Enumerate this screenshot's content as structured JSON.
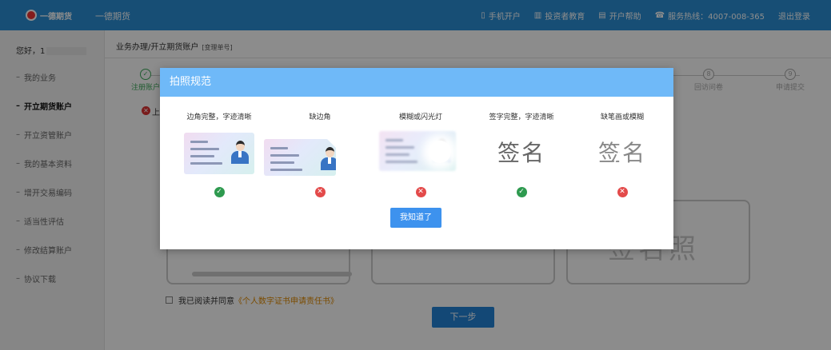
{
  "header": {
    "logo_text": "一德期货",
    "brand": "一德期货",
    "nav": [
      {
        "icon": "mobile-icon",
        "glyph": "▯",
        "label": "手机开户"
      },
      {
        "icon": "education-icon",
        "glyph": "▥",
        "label": "投资者教育"
      },
      {
        "icon": "help-icon",
        "glyph": "▤",
        "label": "开户帮助"
      },
      {
        "icon": "phone-icon",
        "glyph": "☎",
        "label": "服务热线：4007-008-365"
      },
      {
        "icon": "",
        "glyph": "",
        "label": "退出登录"
      }
    ]
  },
  "sidebar": {
    "greeting": "您好，1",
    "items": [
      {
        "label": "我的业务"
      },
      {
        "label": "开立期货账户",
        "active": true
      },
      {
        "label": "开立资管账户"
      },
      {
        "label": "我的基本资料"
      },
      {
        "label": "增开交易编码"
      },
      {
        "label": "适当性评估"
      },
      {
        "label": "修改结算账户"
      },
      {
        "label": "协议下载"
      }
    ]
  },
  "main": {
    "breadcrumb": "业务办理/开立期货账户",
    "breadcrumb_tag": "[变理单号]",
    "steps": [
      {
        "label": "注册账户",
        "mark": "✓",
        "done": true
      },
      {
        "label": "",
        "mark": "",
        "done": false
      },
      {
        "label": "",
        "mark": "",
        "done": false
      },
      {
        "label": "",
        "mark": "",
        "done": false
      },
      {
        "label": "",
        "mark": "",
        "done": false
      },
      {
        "label": "回访问卷",
        "mark": "8",
        "done": false
      },
      {
        "label": "申请提交",
        "mark": "9",
        "done": false
      }
    ],
    "warning_text": "上",
    "photo_placeholder_text": "签名照",
    "agree_prefix": "我已阅读并同意",
    "agree_link": "《个人数字证书申请责任书》",
    "next_button": "下一步"
  },
  "modal": {
    "title": "拍照规范",
    "examples": [
      {
        "caption": "边角完整，字迹清晰",
        "type": "card",
        "status": "ok"
      },
      {
        "caption": "缺边角",
        "type": "card-cut",
        "status": "bad"
      },
      {
        "caption": "模糊或闪光灯",
        "type": "card-blur",
        "status": "bad"
      },
      {
        "caption": "签字完整，字迹清晰",
        "type": "sign",
        "text": "签名",
        "status": "ok"
      },
      {
        "caption": "缺笔画或模糊",
        "type": "sign-broken",
        "text": "签名",
        "status": "bad"
      }
    ],
    "ok_mark": "✓",
    "bad_mark": "✕",
    "ok_button": "我知道了"
  },
  "colors": {
    "header_bg": "#2b8fd6",
    "modal_header_bg": "#6fb9f8",
    "ok_green": "#2e9a4f",
    "bad_red": "#e34a4a",
    "button_blue": "#3d92ee",
    "link_orange": "#e08a00"
  }
}
